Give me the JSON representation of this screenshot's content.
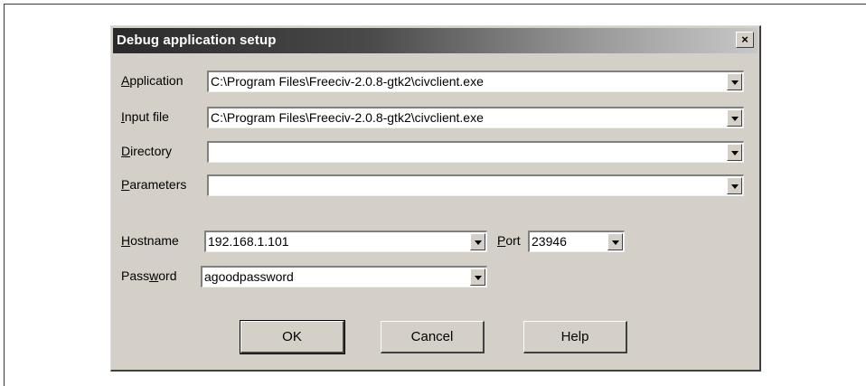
{
  "dialog": {
    "title": "Debug application setup",
    "close_label": "×"
  },
  "fields": {
    "application": {
      "label_pre": "",
      "label_key": "A",
      "label_post": "pplication",
      "value": "C:\\Program Files\\Freeciv-2.0.8-gtk2\\civclient.exe"
    },
    "input_file": {
      "label_pre": "",
      "label_key": "I",
      "label_post": "nput file",
      "value": "C:\\Program Files\\Freeciv-2.0.8-gtk2\\civclient.exe"
    },
    "directory": {
      "label_pre": "",
      "label_key": "D",
      "label_post": "irectory",
      "value": ""
    },
    "parameters": {
      "label_pre": "",
      "label_key": "P",
      "label_post": "arameters",
      "value": ""
    },
    "hostname": {
      "label_pre": "",
      "label_key": "H",
      "label_post": "ostname",
      "value": "192.168.1.101"
    },
    "port": {
      "label_pre": "",
      "label_key": "P",
      "label_post": "ort",
      "value": "23946"
    },
    "password": {
      "label_pre": "Pass",
      "label_key": "w",
      "label_post": "ord",
      "value": "agoodpassword"
    }
  },
  "buttons": {
    "ok": "OK",
    "cancel": "Cancel",
    "help": "Help"
  }
}
